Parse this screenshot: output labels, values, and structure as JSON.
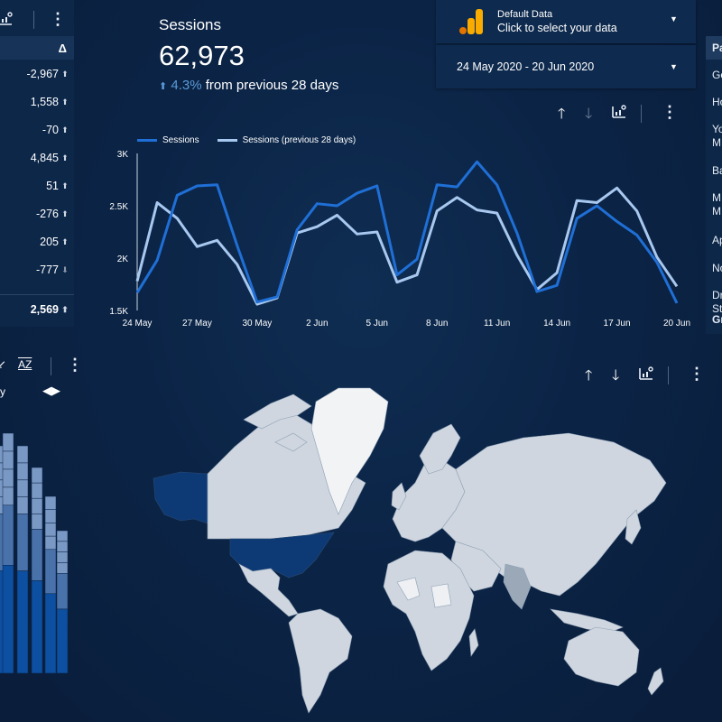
{
  "left_table": {
    "header": "Δ",
    "rows": [
      {
        "value": "-2,967",
        "dir": "up"
      },
      {
        "value": "1,558",
        "dir": "up"
      },
      {
        "value": "-70",
        "dir": "up"
      },
      {
        "value": "4,845",
        "dir": "up"
      },
      {
        "value": "51",
        "dir": "up"
      },
      {
        "value": "-276",
        "dir": "up"
      },
      {
        "value": "205",
        "dir": "up"
      },
      {
        "value": "-777",
        "dir": "down"
      }
    ],
    "total": "2,569",
    "total_dir": "up"
  },
  "kpi": {
    "title": "Sessions",
    "value": "62,973",
    "change_pct": "4.3%",
    "change_text": "from previous 28 days"
  },
  "datasource": {
    "title": "Default Data",
    "subtitle": "Click to select your data"
  },
  "date_range": {
    "label": "24 May 2020 - 20 Jun 2020"
  },
  "right_panel": {
    "header": "Pa",
    "items": [
      "Go",
      "Ho",
      "Yo",
      "M",
      "Ba",
      "M",
      "M",
      "Ap",
      "No",
      "Dr",
      "St",
      "Gr"
    ]
  },
  "left_bars": {
    "a_z_label": "AZ",
    "partial_label": "y"
  },
  "icons": {
    "sort_up": "arrow-up-icon",
    "sort_down": "arrow-down-icon",
    "explore": "explore-icon",
    "more": "kebab-icon",
    "datasource": "analytics-logo-icon",
    "dropdown": "caret-down-icon"
  },
  "colors": {
    "current_series": "#1f6fd6",
    "previous_series": "#a8c8ef",
    "highlight_country": "#0d3a75",
    "other_country": "#cfd6df"
  },
  "chart_data": {
    "type": "line",
    "x": [
      "24 May",
      "25 May",
      "26 May",
      "27 May",
      "28 May",
      "29 May",
      "30 May",
      "31 May",
      "1 Jun",
      "2 Jun",
      "3 Jun",
      "4 Jun",
      "5 Jun",
      "6 Jun",
      "7 Jun",
      "8 Jun",
      "9 Jun",
      "10 Jun",
      "11 Jun",
      "12 Jun",
      "13 Jun",
      "14 Jun",
      "15 Jun",
      "16 Jun",
      "17 Jun",
      "18 Jun",
      "19 Jun",
      "20 Jun"
    ],
    "x_tick_labels": [
      "24 May",
      "27 May",
      "30 May",
      "2 Jun",
      "5 Jun",
      "8 Jun",
      "11 Jun",
      "14 Jun",
      "17 Jun",
      "20 Jun"
    ],
    "y_tick_labels": [
      "3K",
      "2.5K",
      "2K",
      "1.5K"
    ],
    "ylim": [
      1500,
      3000
    ],
    "series": [
      {
        "name": "Sessions",
        "values": [
          1670,
          1980,
          2600,
          2690,
          2700,
          2120,
          1580,
          1630,
          2270,
          2520,
          2500,
          2620,
          2690,
          1840,
          1990,
          2700,
          2680,
          2920,
          2700,
          2240,
          1680,
          1740,
          2380,
          2500,
          2350,
          2220,
          1960,
          1570
        ]
      },
      {
        "name": "Sessions (previous 28 days)",
        "values": [
          1780,
          2530,
          2380,
          2110,
          2170,
          1940,
          1560,
          1620,
          2240,
          2300,
          2410,
          2230,
          2250,
          1770,
          1840,
          2450,
          2580,
          2460,
          2430,
          2030,
          1700,
          1860,
          2550,
          2530,
          2670,
          2450,
          2010,
          1730
        ]
      }
    ]
  }
}
